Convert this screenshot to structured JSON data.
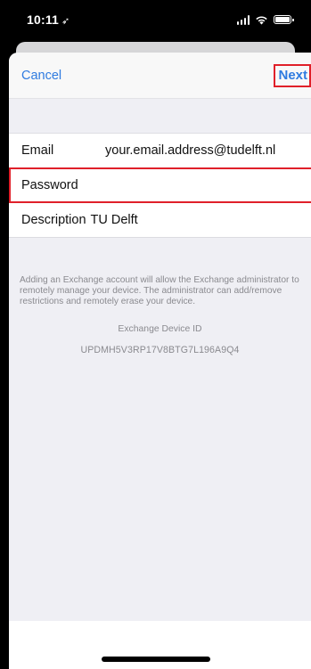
{
  "status_bar": {
    "time": "10:11",
    "location_glyph": "➶"
  },
  "nav": {
    "cancel_label": "Cancel",
    "next_label": "Next"
  },
  "form": {
    "email_label": "Email",
    "email_value": "your.email.address@tudelft.nl",
    "password_label": "Password",
    "description_label": "Description",
    "description_value": "TU Delft"
  },
  "footer": {
    "info": "Adding an Exchange account will allow the Exchange administrator to remotely manage your device. The administrator can add/remove restrictions and remotely erase your device.",
    "device_id_label": "Exchange Device ID",
    "device_id": "UPDMH5V3RP17V8BTG7L196A9Q4"
  },
  "colors": {
    "accent": "#2f7be0",
    "highlight": "#e0202a",
    "secondary_text": "#8a8a8f"
  }
}
